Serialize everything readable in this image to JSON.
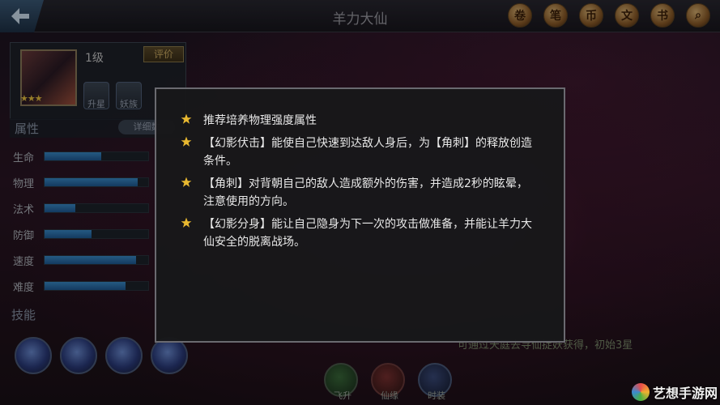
{
  "header": {
    "title": "羊力大仙"
  },
  "top_icons": [
    "scroll-icon",
    "quill-icon",
    "coin-icon",
    "document-icon",
    "book-icon",
    "magnifier-icon"
  ],
  "hero": {
    "level": "1级",
    "rate_label": "评价",
    "stars": "★★★",
    "buttons": [
      "升星",
      "妖族"
    ]
  },
  "attributes": {
    "title": "属性",
    "detail_label": "详细数",
    "rows": [
      {
        "label": "生命",
        "level": 0.55
      },
      {
        "label": "物理",
        "level": 0.9
      },
      {
        "label": "法术",
        "level": 0.3
      },
      {
        "label": "防御",
        "level": 0.45
      },
      {
        "label": "速度",
        "level": 0.88
      },
      {
        "label": "难度",
        "level": 0.78
      }
    ]
  },
  "skills": {
    "title": "技能"
  },
  "note": "可通过天庭去寻仙捉妖获得，初始3星",
  "bottom_buttons": [
    "飞升",
    "仙缘",
    "时装"
  ],
  "watermark": "艺想手游网",
  "popup": {
    "items": [
      "推荐培养物理强度属性",
      "【幻影伏击】能使自己快速到达敌人身后，为【角刺】的释放创造条件。",
      "【角刺】对背朝自己的敌人造成额外的伤害，并造成2秒的眩晕，注意使用的方向。",
      "【幻影分身】能让自己隐身为下一次的攻击做准备，并能让羊力大仙安全的脱离战场。"
    ]
  },
  "colors": {
    "star": "#e8b830",
    "bar": "#2e74b4",
    "popup_border": "#6a6a70"
  }
}
